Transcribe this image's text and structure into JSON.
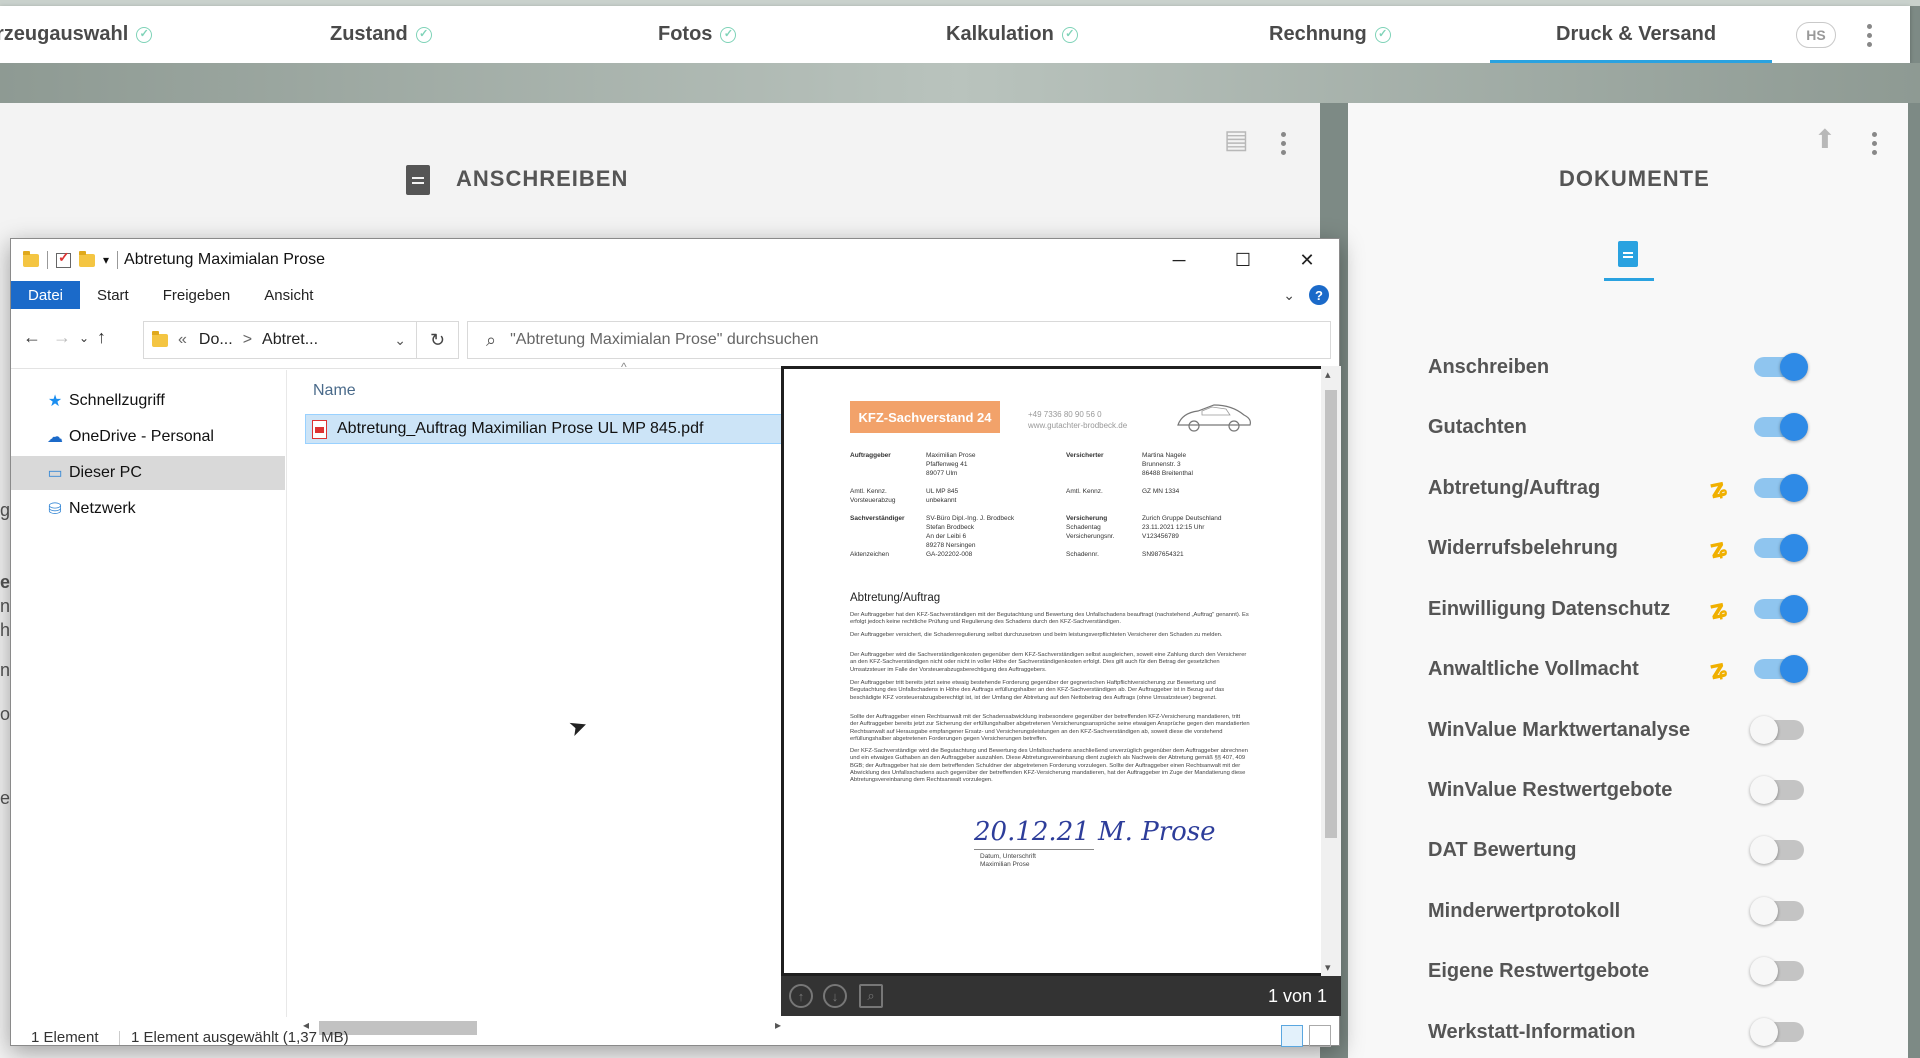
{
  "app": {
    "tabs": [
      {
        "label": "rzeugauswahl",
        "done": true
      },
      {
        "label": "Zustand",
        "done": true
      },
      {
        "label": "Fotos",
        "done": true
      },
      {
        "label": "Kalkulation",
        "done": true
      },
      {
        "label": "Rechnung",
        "done": true
      },
      {
        "label": "Druck & Versand",
        "active": true
      }
    ],
    "user_initials": "HS",
    "left_card_title": "ANSCHREIBEN",
    "right_card_title": "DOKUMENTE",
    "documents": [
      {
        "label": "Anschreiben",
        "enabled": true,
        "signature": false
      },
      {
        "label": "Gutachten",
        "enabled": true,
        "signature": false
      },
      {
        "label": "Abtretung/Auftrag",
        "enabled": true,
        "signature": true
      },
      {
        "label": "Widerrufsbelehrung",
        "enabled": true,
        "signature": true
      },
      {
        "label": "Einwilligung Datenschutz",
        "enabled": true,
        "signature": true
      },
      {
        "label": "Anwaltliche Vollmacht",
        "enabled": true,
        "signature": true
      },
      {
        "label": "WinValue Marktwertanalyse",
        "enabled": false,
        "signature": false
      },
      {
        "label": "WinValue Restwertgebote",
        "enabled": false,
        "signature": false
      },
      {
        "label": "DAT Bewertung",
        "enabled": false,
        "signature": false
      },
      {
        "label": "Minderwertprotokoll",
        "enabled": false,
        "signature": false
      },
      {
        "label": "Eigene Restwertgebote",
        "enabled": false,
        "signature": false
      },
      {
        "label": "Werkstatt-Information",
        "enabled": false,
        "signature": false
      }
    ],
    "left_edge_fragments": [
      "g",
      "e",
      "n",
      "h",
      "n",
      "o",
      "e"
    ],
    "accent_color": "#2aa2e0",
    "toggle_on_color": "#2e8ae6",
    "signature_icon_color": "#f0b000"
  },
  "explorer": {
    "title": "Abtretung Maximialan Prose",
    "ribbon_tabs": [
      "Datei",
      "Start",
      "Freigeben",
      "Ansicht"
    ],
    "help_label": "?",
    "address": {
      "prefix": "«",
      "crumb1": "Do...",
      "sep": ">",
      "crumb2": "Abtret..."
    },
    "search_placeholder": "\"Abtretung Maximialan Prose\" durchsuchen",
    "nav_items": [
      {
        "label": "Schnellzugriff",
        "icon": "star-icon"
      },
      {
        "label": "OneDrive - Personal",
        "icon": "cloud-icon"
      },
      {
        "label": "Dieser PC",
        "icon": "computer-icon",
        "selected": true
      },
      {
        "label": "Netzwerk",
        "icon": "network-icon"
      }
    ],
    "column_name": "Name",
    "file": "Abtretung_Auftrag Maximilian Prose UL MP 845.pdf",
    "status_count": "1 Element",
    "status_selected": "1 Element ausgewählt (1,37 MB)",
    "preview_pages": "1 von 1"
  },
  "document": {
    "brand": "KFZ-Sachverstand 24",
    "phone": "+49 7336 80 90 56 0",
    "web": "www.gutachter-brodbeck.de",
    "auftraggeber_label": "Auftraggeber",
    "auftraggeber": [
      "Maximilian Prose",
      "Pfaffenweg 41",
      "89077 Ulm"
    ],
    "versicherter_label": "Versicherter",
    "versicherter": [
      "Martina Nagele",
      "Brunnenstr. 3",
      "86488 Breitenthal"
    ],
    "kennz_label": "Amtl. Kennz.",
    "kennz": "UL MP 845",
    "kennz2_label": "Amtl. Kennz.",
    "kennz2": "GZ MN 1334",
    "vorsteuer_label": "Vorsteuerabzug",
    "vorsteuer": "unbekannt",
    "sv_label": "Sachverständiger",
    "sv": [
      "SV-Büro Dipl.-Ing. J. Brodbeck",
      "Stefan Brodbeck",
      "An der Leibi 6",
      "89278 Nersingen"
    ],
    "vers_label": "Versicherung",
    "vers": "Zurich Gruppe Deutschland",
    "schadentag_label": "Schadentag",
    "schadentag": "23.11.2021 12:15 Uhr",
    "versnr_label": "Versicherungsnr.",
    "versnr": "V123456789",
    "schadennr_label": "Schadennr.",
    "schadennr": "SN987654321",
    "akten_label": "Aktenzeichen",
    "akten": "GA-202202-008",
    "heading": "Abtretung/Auftrag",
    "paragraphs": [
      "Der Auftraggeber hat den KFZ-Sachverständigen mit der Begutachtung und Bewertung des Unfallschadens beauftragt (nachstehend „Auftrag\" genannt). Es erfolgt jedoch keine rechtliche Prüfung und Regulierung des Schadens durch den KFZ-Sachverständigen.",
      "Der Auftraggeber versichert, die Schadenregulierung selbst durchzusetzen und beim leistungsverpflichteten Versicherer den Schaden zu melden.",
      "Der Auftraggeber wird die Sachverständigenkosten gegenüber dem KFZ-Sachverständigen selbst ausgleichen, soweit eine Zahlung durch den Versicherer an den KFZ-Sachverständigen nicht oder nicht in voller Höhe der Sachverständigenkosten erfolgt. Dies gilt auch für den Betrag der gesetzlichen Umsatzsteuer im Falle der Vorsteuerabzugsberechtigung des Auftraggebers.",
      "Der Auftraggeber tritt bereits jetzt seine etwaig bestehende Forderung gegenüber der gegnerischen Haftpflichtversicherung zur Bewertung und Begutachtung des Unfallschadens in Höhe des Auftrags erfüllungshalber an den KFZ-Sachverständigen ab. Der Auftraggeber ist in Bezug auf das beschädigte KFZ vorsteuerabzugsberechtigt ist, ist der Umfang der Abtretung auf den Nettobetrag des Auftrags (ohne Umsatzsteuer) begrenzt.",
      "Sollte der Auftraggeber einen Rechtsanwalt mit der Schadensabwicklung insbesondere gegenüber der betreffenden KFZ-Versicherung mandatieren, tritt der Auftraggeber bereits jetzt zur Sicherung der erfüllungshalber abgetretenen Versicherungsansprüche seine etwaigen Ansprüche gegen den mandatierten Rechtsanwalt auf Herausgabe empfangener Ersatz- und Versicherungsleistungen an den KFZ-Sachverständigen ab, soweit diese die vorstehend erfüllungshalber abgetretenen Forderungen gegen Versicherungen betreffen.",
      "Der KFZ-Sachverständige wird die Begutachtung und Bewertung des Unfallsschadens anschließend unverzüglich gegenüber dem Auftraggeber abrechnen und ein etwaiges Guthaben an den Auftraggeber auszahlen. Diese Abtretungsvereinbarung dient zugleich als Nachweis der Abtretung gemäß §§ 407, 409 BGB; der Auftraggeber hat sie dem betreffenden Schuldner der abgetretenen Forderung vorzulegen. Sollte der Auftraggeber einen Rechtsanwalt mit der Abwicklung des Unfallsschadens auch gegenüber der betreffenden KFZ-Versicherung mandatieren, hat der Auftraggeber im Zuge der Mandatierung diese Abtretungsvereinbarung dem Rechtsanwalt vorzulegen."
    ],
    "signature": "20.12.21 M. Prose",
    "sig_caption_1": "Datum, Unterschrift",
    "sig_caption_2": "Maximilian Prose"
  }
}
